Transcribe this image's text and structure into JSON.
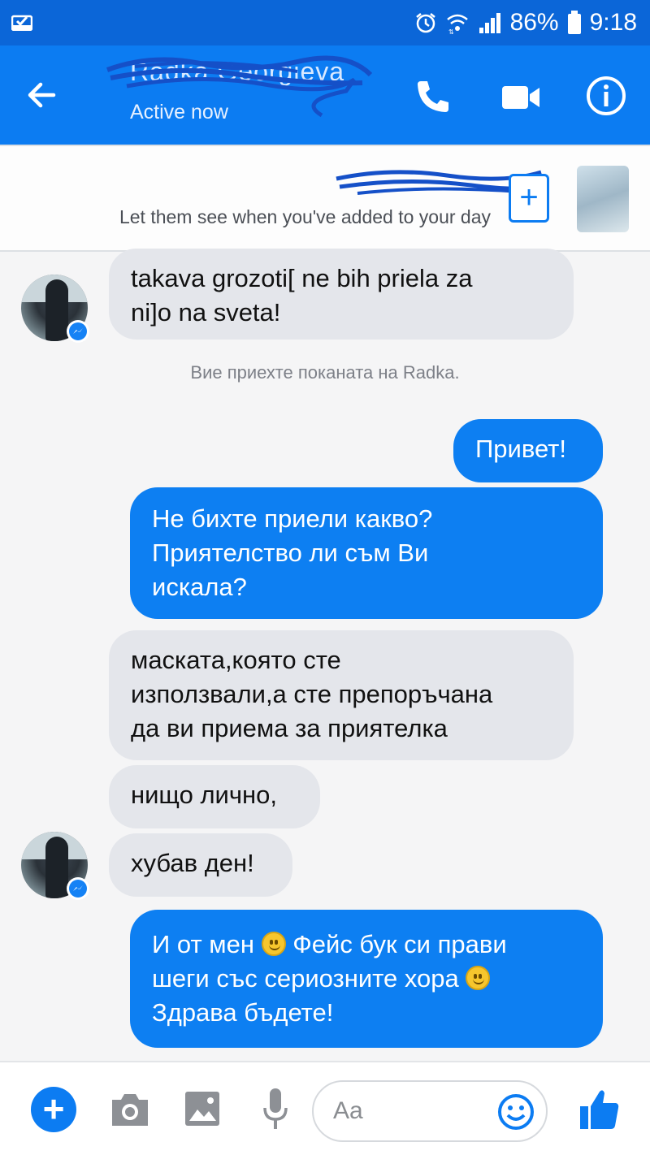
{
  "status_bar": {
    "battery": "86%",
    "time": "9:18",
    "icons": [
      "notification-icon",
      "alarm-icon",
      "wifi-icon",
      "signal-icon",
      "battery-icon"
    ]
  },
  "header": {
    "contact_name": "Radka Georgieva",
    "status": "Active now",
    "icons": [
      "back-arrow-icon",
      "phone-icon",
      "video-camera-icon",
      "info-icon"
    ]
  },
  "story_bar": {
    "prompt": "Let them see when you've added to your day",
    "icons": [
      "add-story-icon"
    ]
  },
  "messages": [
    {
      "side": "in",
      "lines": [
        "takava grozoti[ ne bih priela za",
        "ni]o na sveta!"
      ]
    },
    {
      "side": "system",
      "text": "Вие приехте поканата на Radka."
    },
    {
      "side": "out",
      "lines": [
        "Привет!"
      ]
    },
    {
      "side": "out",
      "lines": [
        "Не бихте приели какво?",
        "Приятелство ли съм Ви",
        "искала?"
      ]
    },
    {
      "side": "in",
      "lines": [
        "маската,която сте",
        "използвали,а сте препоръчана",
        "да ви приема за приятелка"
      ]
    },
    {
      "side": "in",
      "lines": [
        "нищо лично,"
      ]
    },
    {
      "side": "in",
      "lines": [
        "хубав ден!"
      ]
    },
    {
      "side": "out",
      "parts": [
        "И от мен",
        "Фейс бук си прави",
        "шеги със сериозните хора",
        "Здрава бъдете!"
      ]
    }
  ],
  "composer": {
    "placeholder": "Aa",
    "icons": [
      "plus-icon",
      "camera-icon",
      "image-icon",
      "microphone-icon",
      "emoji-icon",
      "thumbs-up-icon"
    ]
  },
  "colors": {
    "status_bar": "#0b66d8",
    "header": "#0c7cf2",
    "outgoing_bubble": "#0d7ff2",
    "incoming_bubble": "#e4e6eb",
    "background": "#f5f5f6"
  }
}
